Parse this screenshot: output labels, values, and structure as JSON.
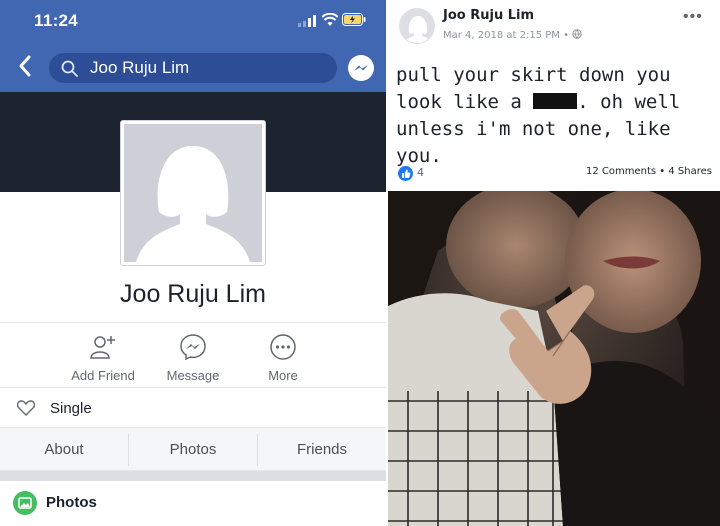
{
  "status": {
    "time": "11:24"
  },
  "search": {
    "query": "Joo Ruju Lim"
  },
  "profile": {
    "name": "Joo Ruju Lim",
    "actions": [
      {
        "label": "Add Friend",
        "icon": "add-friend-icon"
      },
      {
        "label": "Message",
        "icon": "messenger-icon"
      },
      {
        "label": "More",
        "icon": "more-icon"
      }
    ],
    "relationship": "Single",
    "tabs": [
      "About",
      "Photos",
      "Friends"
    ],
    "photos_section": "Photos"
  },
  "post": {
    "author": "Joo Ruju Lim",
    "date": "Mar 4, 2018 at 2:15 PM",
    "privacy_icon": "globe-icon",
    "text_before": "pull your skirt down you look like a",
    "text_after": ". oh well unless i'm not one, like you.",
    "likes": "4",
    "stats": "12 Comments • 4 Shares"
  },
  "colors": {
    "brand": "#4267b2",
    "cover": "#1d2430",
    "like": "#2078f4",
    "photos_icon": "#45bd62"
  }
}
